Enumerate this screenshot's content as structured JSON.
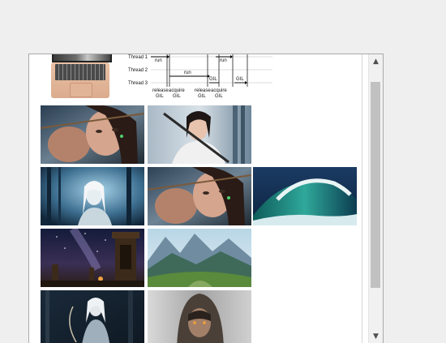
{
  "diagram": {
    "threads": [
      "Thread 1",
      "Thread 2",
      "Thread 3"
    ],
    "run_labels": [
      "run",
      "run",
      "run"
    ],
    "gil_labels": [
      "GIL",
      "GIL"
    ],
    "release_label": "release",
    "acquire_label": "acquire",
    "gil_word": "GIL"
  },
  "images": [
    {
      "name": "archer-woman-closeup",
      "icon": "archer-portrait"
    },
    {
      "name": "swordswoman-forest",
      "icon": "swordswoman"
    },
    {
      "name": "elf-woman-blue-forest",
      "icon": "elf-portrait"
    },
    {
      "name": "archer-woman-closeup-repeat",
      "icon": "archer-portrait"
    },
    {
      "name": "ocean-wave",
      "icon": "wave"
    },
    {
      "name": "ruins-starry-night",
      "icon": "ruins"
    },
    {
      "name": "mountain-valley",
      "icon": "landscape"
    },
    {
      "name": "elf-archer-dark-forest",
      "icon": "elf-archer"
    },
    {
      "name": "hooded-warrior",
      "icon": "hooded-figure"
    }
  ],
  "scrollbar": {
    "up_glyph": "▲",
    "down_glyph": "▼"
  }
}
